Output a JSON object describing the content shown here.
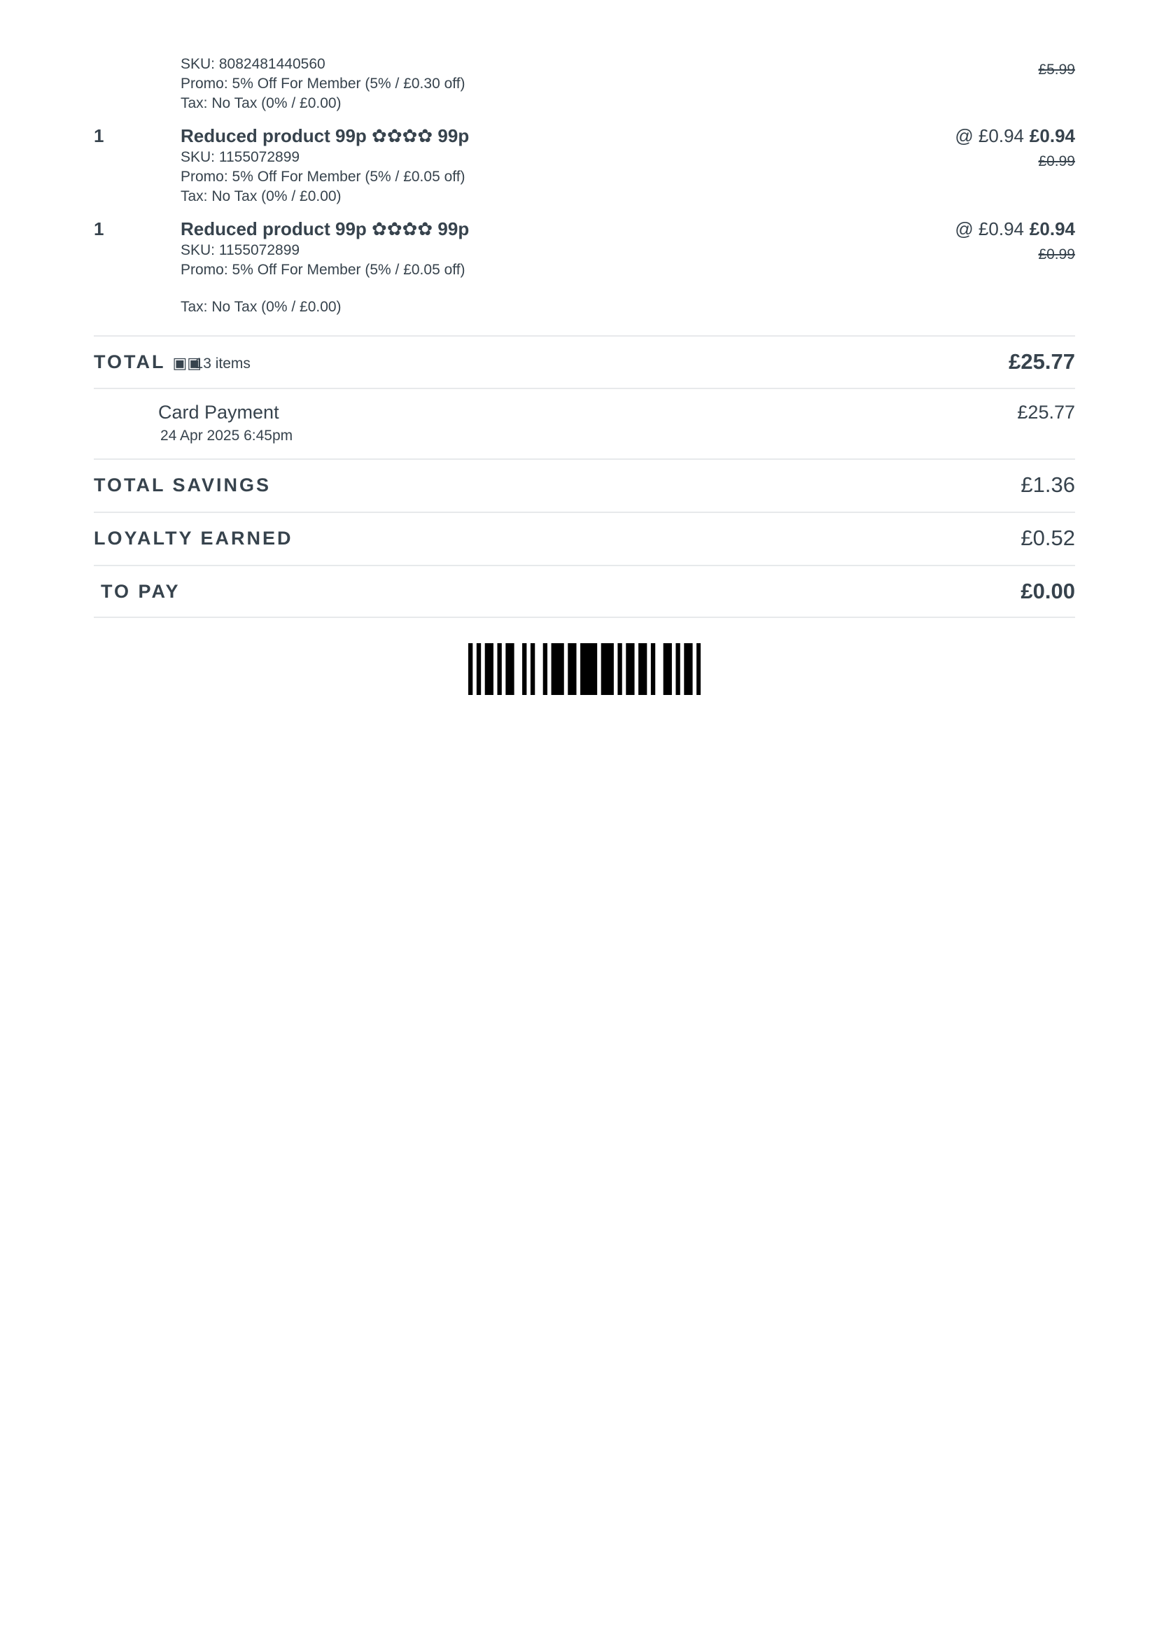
{
  "items": [
    {
      "qty": "",
      "name": "",
      "sku": "SKU: 8082481440560",
      "promo": "Promo: 5% Off For Member (5% / £0.30 off)",
      "tax": "Tax:  No Tax (0% / £0.00)",
      "unit_price": "",
      "line_total": "",
      "was_price": "£5.99"
    },
    {
      "qty": "1",
      "name": "Reduced product 99p ✿✿✿✿ 99p",
      "sku": "SKU: 1155072899",
      "promo": "Promo: 5% Off For Member (5% / £0.05 off)",
      "tax": "Tax:  No Tax (0% / £0.00)",
      "unit_price": "@ £0.94",
      "line_total": "£0.94",
      "was_price": "£0.99"
    },
    {
      "qty": "1",
      "name": "Reduced product 99p ✿✿✿✿ 99p",
      "sku": "SKU: 1155072899",
      "promo": "Promo: 5% Off For Member (5% / £0.05 off)",
      "tax": "Tax:  No Tax (0% / £0.00)",
      "unit_price": "@ £0.94",
      "line_total": "£0.94",
      "was_price": "£0.99"
    }
  ],
  "total": {
    "label": "TOTAL",
    "icon": "bag-icon",
    "count": "13 items",
    "amount": "£25.77"
  },
  "payment": {
    "method": "Card Payment",
    "date": "24 Apr 2025 6:45pm",
    "amount": "£25.77"
  },
  "savings": {
    "label": "TOTAL SAVINGS",
    "amount": "£1.36"
  },
  "loyalty": {
    "label": "LOYALTY EARNED",
    "amount": "£0.52"
  },
  "to_pay": {
    "label": "TO PAY",
    "amount": "£0.00"
  },
  "barcode": {
    "bars": [
      1,
      0,
      1,
      0,
      1,
      1,
      0,
      1,
      0,
      1,
      1,
      0,
      0,
      1,
      0,
      1,
      0,
      0,
      1,
      0,
      1,
      1,
      1,
      0,
      1,
      1,
      0,
      1,
      1,
      1,
      1,
      0,
      1,
      1,
      1,
      0,
      1,
      0,
      1,
      1,
      0,
      1,
      1,
      0,
      1,
      0,
      0,
      1,
      1,
      0,
      1,
      0,
      1,
      1,
      0,
      1
    ]
  },
  "colors": {
    "text": "#37434d",
    "divider": "#e7e9eb"
  }
}
